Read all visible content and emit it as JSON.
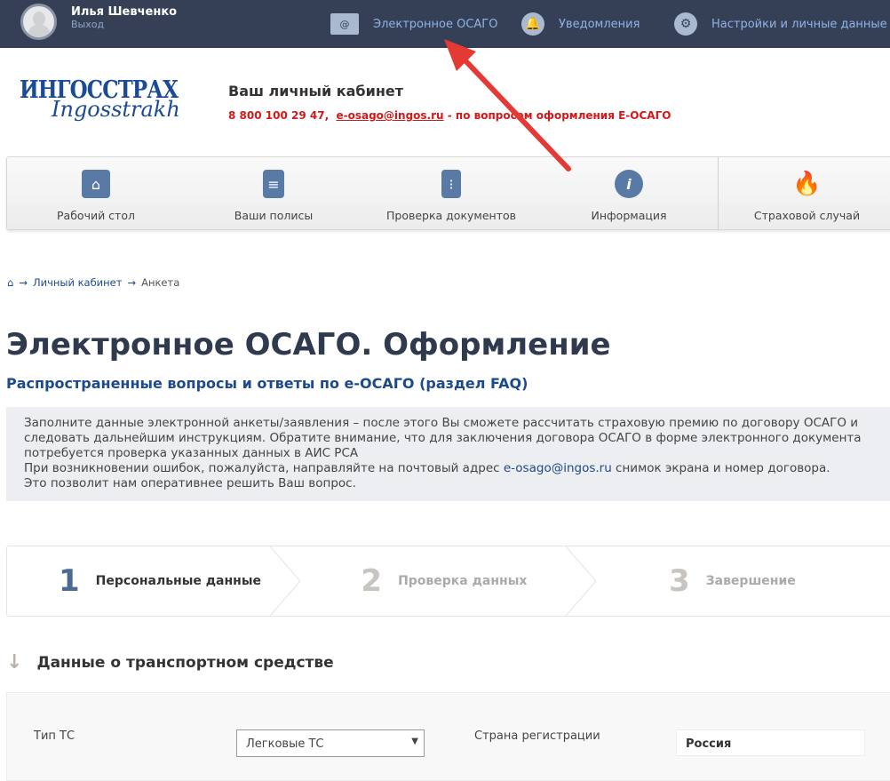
{
  "topbar": {
    "user_name": "Илья Шевченко",
    "logout": "Выход",
    "nav": [
      {
        "label": "Электронное ОСАГО",
        "icon": "envelope-icon"
      },
      {
        "label": "Уведомления",
        "icon": "bell-icon"
      },
      {
        "label": "Настройки и личные данные",
        "icon": "gear-icon"
      }
    ]
  },
  "header": {
    "logo_ru": "ИНГОССТРАХ",
    "logo_en": "Ingosstrakh",
    "title": "Ваш личный кабинет",
    "phone": "8 800 100 29 47",
    "email": "e-osago@ingos.ru",
    "contact_note": "- по вопросам оформления Е-ОСАГО"
  },
  "main_nav": [
    {
      "label": "Рабочий стол",
      "icon": "desktop-icon"
    },
    {
      "label": "Ваши полисы",
      "icon": "document-icon"
    },
    {
      "label": "Проверка документов",
      "icon": "calculator-icon"
    },
    {
      "label": "Информация",
      "icon": "info-icon"
    },
    {
      "label": "Страховой случай",
      "icon": "flame-icon"
    }
  ],
  "breadcrumb": {
    "items": [
      "Личный кабинет",
      "Анкета"
    ],
    "separator": "→"
  },
  "page": {
    "title": "Электронное ОСАГО. Оформление",
    "faq_link": "Распространенные вопросы и ответы по е-ОСАГО (раздел FAQ)",
    "info_p1": "Заполните данные электронной анкеты/заявления – после этого Вы сможете рассчитать страховую премию по договору ОСАГО и следовать дальнейшим инструкциям. Обратите внимание, что для заключения договора ОСАГО в форме электронного документа потребуется проверка указанных данных в АИС РСА",
    "info_p2a": "При возникновении ошибок, пожалуйста, направляйте на почтовый адрес ",
    "info_email": "e-osago@ingos.ru",
    "info_p2b": " снимок экрана и номер договора.",
    "info_p3": "Это позволит нам оперативнее решить Ваш вопрос."
  },
  "steps": [
    {
      "num": "1",
      "label": "Персональные данные",
      "active": true
    },
    {
      "num": "2",
      "label": "Проверка данных"
    },
    {
      "num": "3",
      "label": "Завершение"
    }
  ],
  "section": {
    "title": "Данные о транспортном средстве"
  },
  "form": {
    "vehicle_type_label": "Тип ТС",
    "vehicle_type_value": "Легковые ТС",
    "country_label": "Страна регистрации",
    "country_value": "Россия"
  },
  "colors": {
    "topbar": "#354057",
    "accent": "#1c4a8a",
    "red": "#d01a1a"
  }
}
